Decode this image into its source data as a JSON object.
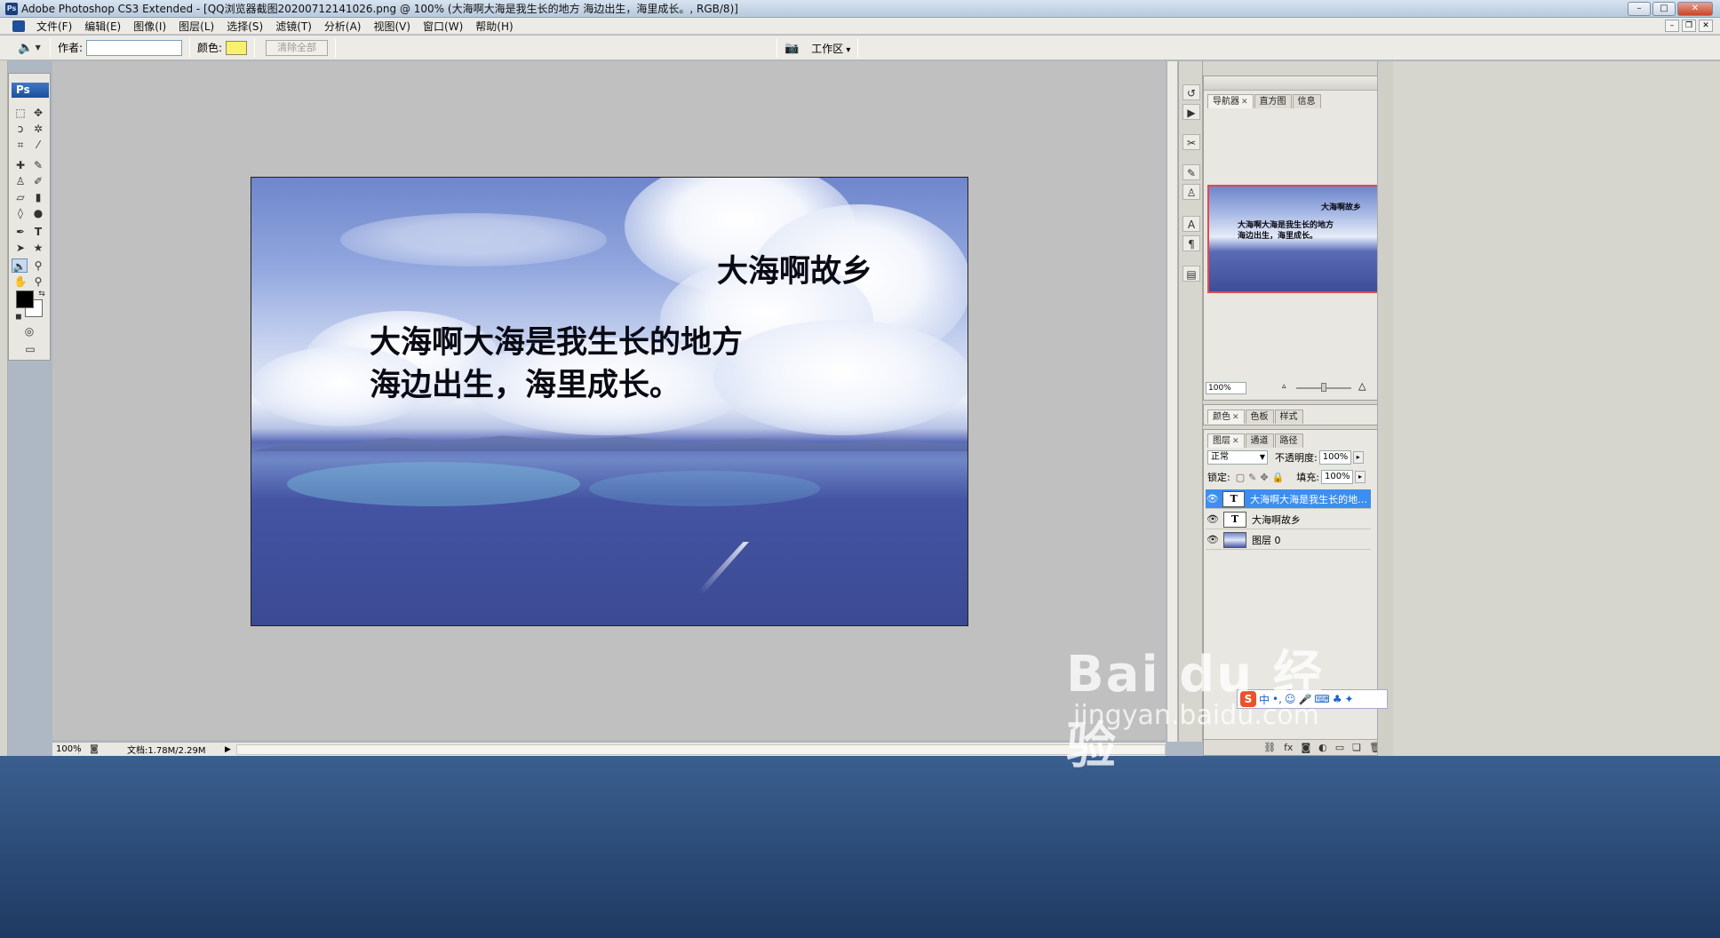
{
  "window": {
    "app_icon": "Ps",
    "title": "Adobe Photoshop CS3 Extended - [QQ浏览器截图20200712141026.png @ 100% (大海啊大海是我生长的地方 海边出生，海里成长。, RGB/8)]",
    "controls": {
      "minimize": "–",
      "maximize": "□",
      "close": "✕"
    }
  },
  "menu": {
    "items": [
      "文件(F)",
      "编辑(E)",
      "图像(I)",
      "图层(L)",
      "选择(S)",
      "滤镜(T)",
      "分析(A)",
      "视图(V)",
      "窗口(W)",
      "帮助(H)"
    ]
  },
  "options_bar": {
    "tool_icon": "audio-annotation-icon",
    "author_label": "作者:",
    "author_value": "",
    "color_label": "颜色:",
    "swatch_color": "#f8f06e",
    "clear_all_label": "清除全部",
    "workspace_label": "工作区"
  },
  "tools_panel": {
    "logo": "Ps",
    "tools": [
      "marquee-icon",
      "move-icon",
      "lasso-icon",
      "magic-wand-icon",
      "crop-icon",
      "slice-icon",
      "healing-brush-icon",
      "brush-icon",
      "clone-stamp-icon",
      "history-brush-icon",
      "eraser-icon",
      "gradient-icon",
      "blur-icon",
      "dodge-icon",
      "pen-icon",
      "type-icon",
      "path-selection-icon",
      "shape-icon",
      "notes-icon",
      "eyedropper-icon",
      "hand-icon",
      "zoom-icon"
    ],
    "foreground_color": "#000000",
    "background_color": "#ffffff"
  },
  "document": {
    "title_text": "大海啊故乡",
    "body_line1": "大海啊大海是我生长的地方",
    "body_line2": "海边出生，海里成长。"
  },
  "status_bar": {
    "zoom": "100%",
    "doc_info": "文档:1.78M/2.29M"
  },
  "navigator_panel": {
    "tabs": [
      "导航器",
      "直方图",
      "信息"
    ],
    "active_tab": "导航器",
    "zoom_value": "100%"
  },
  "color_panel": {
    "tabs": [
      "颜色",
      "色板",
      "样式"
    ]
  },
  "layers_panel": {
    "tabs": [
      "图层",
      "通道",
      "路径"
    ],
    "blend_mode": "正常",
    "opacity_label": "不透明度:",
    "opacity_value": "100%",
    "lock_label": "锁定:",
    "fill_label": "填充:",
    "fill_value": "100%",
    "layers": [
      {
        "name": "大海啊大海是我生长的地方...",
        "type": "T",
        "selected": true
      },
      {
        "name": "大海啊故乡",
        "type": "T",
        "selected": false
      },
      {
        "name": "图层 0",
        "type": "image",
        "selected": false
      }
    ],
    "footer_icons": [
      "link-icon",
      "fx-icon",
      "mask-icon",
      "adjustment-icon",
      "group-icon",
      "new-layer-icon",
      "trash-icon"
    ]
  },
  "ime": {
    "logo": "S",
    "mode": "中"
  },
  "watermark": {
    "logo": "Bai du 经验",
    "url": "jingyan.baidu.com"
  }
}
